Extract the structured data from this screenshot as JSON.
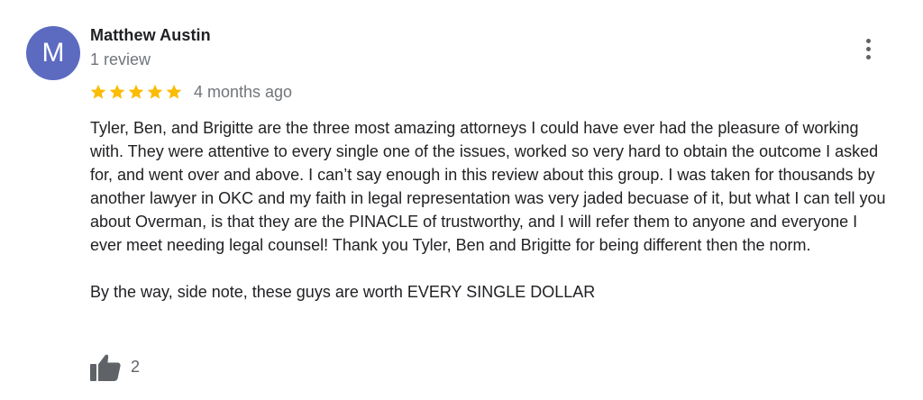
{
  "reviewer": {
    "initial": "M",
    "name": "Matthew Austin",
    "review_count": "1 review",
    "avatar_color": "#5c6bc0"
  },
  "rating": {
    "stars": 5,
    "max_stars": 5,
    "star_color": "#fbbc04",
    "time": "4 months ago"
  },
  "review": {
    "paragraph1": "Tyler, Ben, and Brigitte are the three most amazing attorneys I could have ever had the pleasure of working with. They were attentive to every single one of the issues, worked so very hard to obtain the outcome I asked for, and went over and above. I can’t say enough in this review about this group. I was taken for thousands by another lawyer in OKC and my faith in legal representation was very jaded becuase of it, but what I can tell you about Overman, is that they are the PINACLE of trustworthy, and I will refer them to anyone and everyone I ever meet needing legal counsel! Thank you Tyler, Ben and Brigitte for being different then the norm.",
    "paragraph2": "By the way, side note, these guys are worth EVERY SINGLE DOLLAR"
  },
  "actions": {
    "like_count": "2",
    "like_icon": "thumbs-up-icon",
    "menu_icon": "more-vert-icon"
  }
}
